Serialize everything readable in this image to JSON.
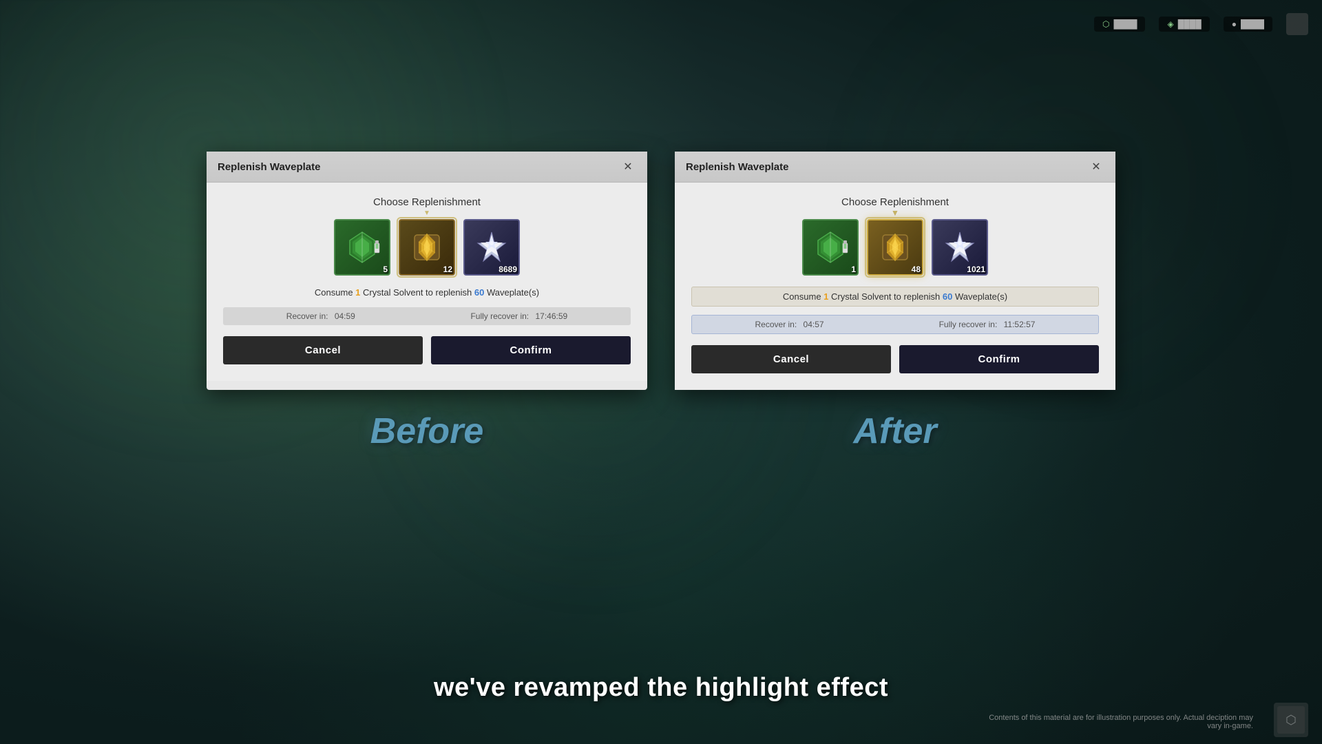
{
  "background": {
    "color": "#1a2e2e"
  },
  "before_dialog": {
    "title": "Replenish Waveplate",
    "choose_label": "Choose Replenishment",
    "items": [
      {
        "id": "crystal-solvent",
        "type": "crystal",
        "count": "5",
        "selected": false
      },
      {
        "id": "gold-crystal",
        "type": "gold",
        "count": "12",
        "selected": true
      },
      {
        "id": "star-item",
        "type": "star",
        "count": "8689",
        "selected": false
      }
    ],
    "consume_text_pre": "Consume ",
    "consume_num": "1",
    "consume_mid": " Crystal Solvent to replenish ",
    "consume_wp": "60",
    "consume_post": " Waveplate(s)",
    "recover_label": "Recover in:",
    "recover_time": "04:59",
    "fully_recover_label": "Fully recover in:",
    "fully_recover_time": "17:46:59",
    "cancel_label": "Cancel",
    "confirm_label": "Confirm"
  },
  "after_dialog": {
    "title": "Replenish Waveplate",
    "choose_label": "Choose Replenishment",
    "items": [
      {
        "id": "crystal-solvent",
        "type": "crystal",
        "count": "1",
        "selected": false
      },
      {
        "id": "gold-crystal",
        "type": "gold",
        "count": "48",
        "selected": true
      },
      {
        "id": "star-item",
        "type": "star",
        "count": "1021",
        "selected": false
      }
    ],
    "consume_text_pre": "Consume ",
    "consume_num": "1",
    "consume_mid": " Crystal Solvent to replenish ",
    "consume_wp": "60",
    "consume_post": " Waveplate(s)",
    "recover_label": "Recover in:",
    "recover_time": "04:57",
    "fully_recover_label": "Fully recover in:",
    "fully_recover_time": "11:52:57",
    "cancel_label": "Cancel",
    "confirm_label": "Confirm"
  },
  "labels": {
    "before": "Before",
    "after": "After"
  },
  "subtitle": "we've revamped the highlight effect",
  "disclaimer": "Contents of this material are for illustration purposes only. Actual deciption may vary in-game.",
  "icons": {
    "close": "✕",
    "dropdown": "▼"
  }
}
